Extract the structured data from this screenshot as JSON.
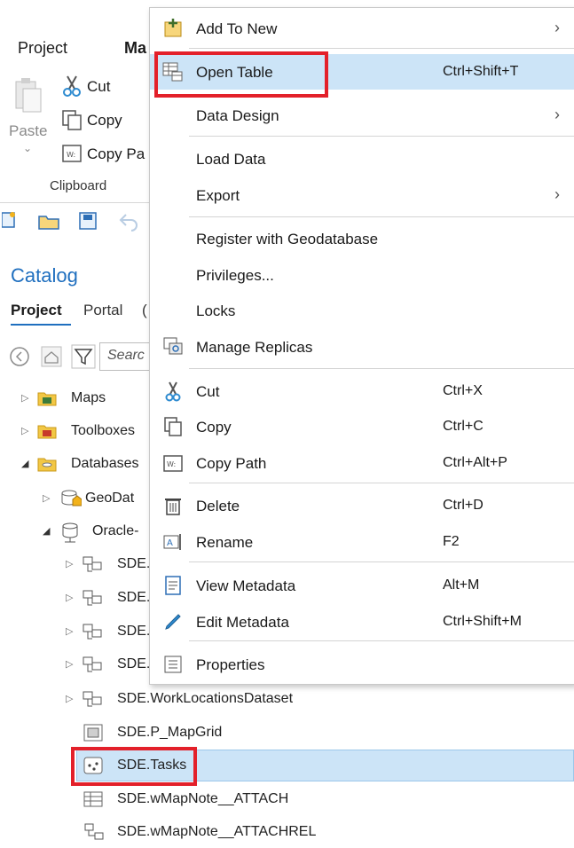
{
  "ribbon": {
    "tabs": [
      "Project",
      "Ma"
    ],
    "clipboard": {
      "paste": "Paste",
      "cut": "Cut",
      "copy": "Copy",
      "copy_path": "Copy Pa",
      "group_label": "Clipboard"
    }
  },
  "catalog": {
    "title": "Catalog",
    "tabs": [
      "Project",
      "Portal",
      "("
    ],
    "search_placeholder": "Searc",
    "tree": [
      {
        "label": "Maps",
        "icon": "maps-folder-icon",
        "expander": "▷"
      },
      {
        "label": "Toolboxes",
        "icon": "toolboxes-folder-icon",
        "expander": "▷"
      },
      {
        "label": "Databases",
        "icon": "databases-folder-icon",
        "expander": "◢"
      },
      {
        "label": "GeoDat",
        "icon": "geodatabase-icon",
        "expander": "▷"
      },
      {
        "label": "Oracle-",
        "icon": "database-connection-icon",
        "expander": "◢"
      },
      {
        "label": "SDE.",
        "icon": "feature-dataset-icon",
        "expander": "▷"
      },
      {
        "label": "SDE.",
        "icon": "feature-dataset-icon",
        "expander": "▷"
      },
      {
        "label": "SDE.",
        "icon": "feature-dataset-icon",
        "expander": "▷"
      },
      {
        "label": "SDE.",
        "icon": "feature-dataset-icon",
        "expander": "▷"
      },
      {
        "label": "SDE.WorkLocationsDataset",
        "icon": "feature-dataset-icon",
        "expander": "▷"
      },
      {
        "label": "SDE.P_MapGrid",
        "icon": "polygon-feature-class-icon",
        "expander": ""
      },
      {
        "label": "SDE.Tasks",
        "icon": "point-feature-class-icon",
        "expander": ""
      },
      {
        "label": "SDE.wMapNote__ATTACH",
        "icon": "table-icon",
        "expander": ""
      },
      {
        "label": "SDE.wMapNote__ATTACHREL",
        "icon": "relationship-class-icon",
        "expander": ""
      }
    ]
  },
  "context_menu": {
    "items": [
      {
        "label": "Add To New",
        "shortcut": "",
        "submenu": true,
        "icon": "add-to-new-icon"
      },
      {
        "label": "Open Table",
        "shortcut": "Ctrl+Shift+T",
        "submenu": false,
        "icon": "open-table-icon"
      },
      {
        "label": "Data Design",
        "shortcut": "",
        "submenu": true,
        "icon": ""
      },
      {
        "label": "Load Data",
        "shortcut": "",
        "submenu": false,
        "icon": ""
      },
      {
        "label": "Export",
        "shortcut": "",
        "submenu": true,
        "icon": ""
      },
      {
        "label": "Register with Geodatabase",
        "shortcut": "",
        "submenu": false,
        "icon": ""
      },
      {
        "label": "Privileges...",
        "shortcut": "",
        "submenu": false,
        "icon": ""
      },
      {
        "label": "Locks",
        "shortcut": "",
        "submenu": false,
        "icon": ""
      },
      {
        "label": "Manage Replicas",
        "shortcut": "",
        "submenu": false,
        "icon": "manage-replicas-icon"
      },
      {
        "label": "Cut",
        "shortcut": "Ctrl+X",
        "submenu": false,
        "icon": "scissors-icon"
      },
      {
        "label": "Copy",
        "shortcut": "Ctrl+C",
        "submenu": false,
        "icon": "copy-icon"
      },
      {
        "label": "Copy Path",
        "shortcut": "Ctrl+Alt+P",
        "submenu": false,
        "icon": "copy-path-icon"
      },
      {
        "label": "Delete",
        "shortcut": "Ctrl+D",
        "submenu": false,
        "icon": "trash-icon"
      },
      {
        "label": "Rename",
        "shortcut": "F2",
        "submenu": false,
        "icon": "rename-icon"
      },
      {
        "label": "View Metadata",
        "shortcut": "Alt+M",
        "submenu": false,
        "icon": "view-metadata-icon"
      },
      {
        "label": "Edit Metadata",
        "shortcut": "Ctrl+Shift+M",
        "submenu": false,
        "icon": "pencil-icon"
      },
      {
        "label": "Properties",
        "shortcut": "",
        "submenu": false,
        "icon": "properties-icon"
      }
    ],
    "submenu_arrow": "›"
  },
  "colors": {
    "highlight": "#cce4f7",
    "selected_row": "#cce4f7",
    "annotation_red": "#e3202a",
    "catalog_title": "#1f6fbf"
  }
}
